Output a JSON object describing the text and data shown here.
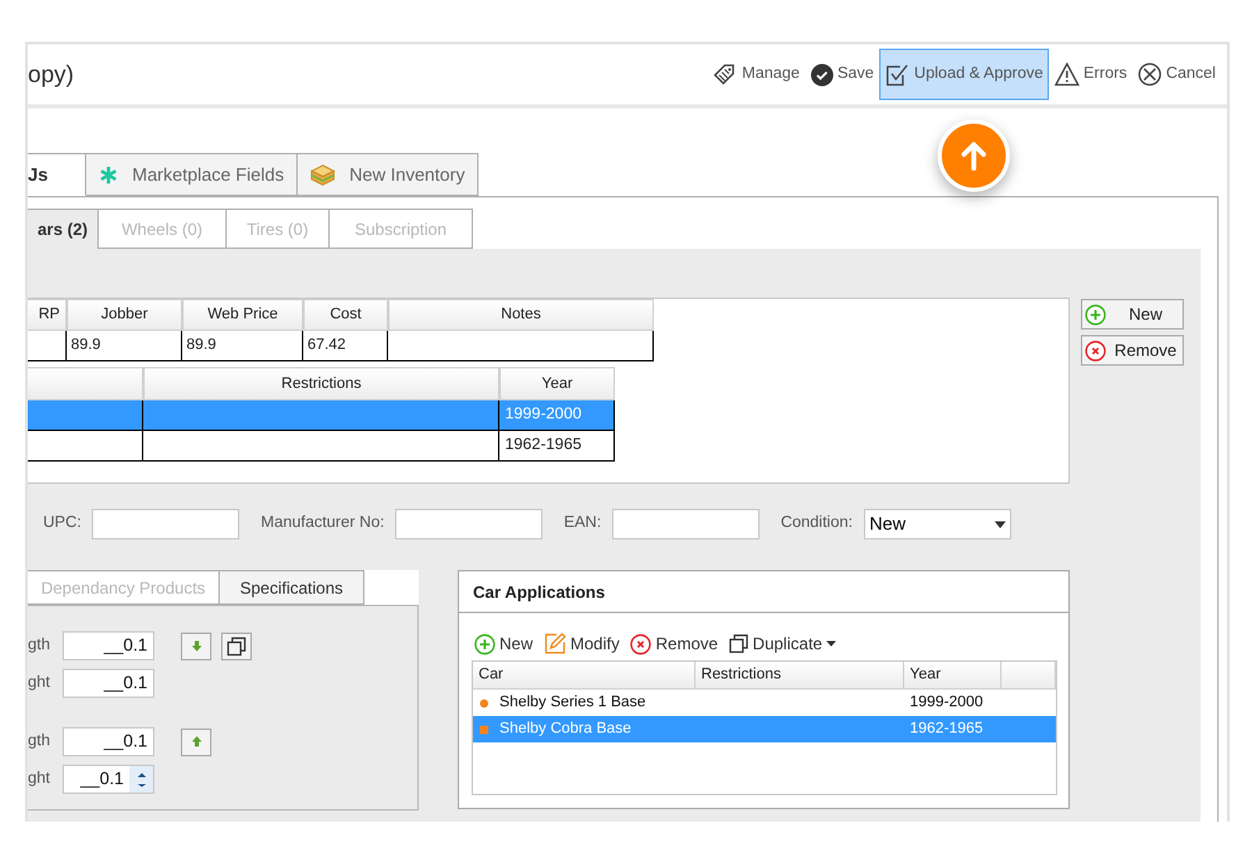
{
  "header": {
    "title": "opy)",
    "actions": [
      {
        "label": "Manage",
        "selected": false
      },
      {
        "label": "Save",
        "selected": false
      },
      {
        "label": "Upload & Approve",
        "selected": true
      },
      {
        "label": "Errors",
        "selected": false
      },
      {
        "label": "Cancel",
        "selected": false
      }
    ]
  },
  "tabs": [
    {
      "label": "Js",
      "selected": true
    },
    {
      "label": "Marketplace Fields",
      "selected": false
    },
    {
      "label": "New Inventory",
      "selected": false
    }
  ],
  "subtabs": [
    {
      "label": "ars (2)",
      "selected": true,
      "disabled": false
    },
    {
      "label": "Wheels (0)",
      "selected": false,
      "disabled": true
    },
    {
      "label": "Tires (0)",
      "selected": false,
      "disabled": true
    },
    {
      "label": "Subscription",
      "selected": false,
      "disabled": true
    }
  ],
  "pricing_table": {
    "columns": [
      "RP",
      "Jobber",
      "Web Price",
      "Cost",
      "Notes"
    ],
    "rows": [
      {
        "cells": [
          null,
          "89.9",
          "89.9",
          "67.42",
          null
        ]
      }
    ]
  },
  "applications_table": {
    "columns": [
      null,
      "Restrictions",
      "Year"
    ],
    "rows": [
      {
        "year": "1999-2000",
        "selected": true
      },
      {
        "year": "1962-1965",
        "selected": false
      }
    ]
  },
  "side_buttons": [
    {
      "label": "New"
    },
    {
      "label": "Remove"
    }
  ],
  "fields": [
    {
      "label": "UPC:",
      "kind": "text"
    },
    {
      "label": "Manufacturer No:",
      "kind": "text"
    },
    {
      "label": "EAN:",
      "kind": "text"
    },
    {
      "label": "Condition:",
      "kind": "select",
      "value": "New"
    }
  ],
  "spec_tabs": [
    {
      "label": "Dependancy Products",
      "selected": false,
      "disabled": true
    },
    {
      "label": "Specifications",
      "selected": true,
      "disabled": false
    }
  ],
  "spec_groups": [
    {
      "rows": [
        {
          "label": "gth",
          "value": "__0.1",
          "kind": "move-down"
        },
        {
          "label": "ght",
          "value": "__0.1",
          "kind": "plain"
        }
      ]
    },
    {
      "rows": [
        {
          "label": "gth",
          "value": "__0.1",
          "kind": "move-up"
        },
        {
          "label": "ght",
          "value": "__0.1",
          "kind": "spinner"
        }
      ]
    }
  ],
  "car_applications": {
    "title": "Car Applications",
    "toolbar": [
      {
        "label": "New",
        "dropdown": false
      },
      {
        "label": "Modify",
        "dropdown": false
      },
      {
        "label": "Remove",
        "dropdown": false
      },
      {
        "label": "Duplicate",
        "dropdown": true
      }
    ],
    "columns": [
      "Car",
      "Restrictions",
      "Year",
      null
    ],
    "rows": [
      {
        "car": "Shelby Series 1 Base",
        "year": "1999-2000",
        "selected": false
      },
      {
        "car": "Shelby Cobra Base",
        "year": "1962-1965",
        "selected": true
      }
    ]
  }
}
